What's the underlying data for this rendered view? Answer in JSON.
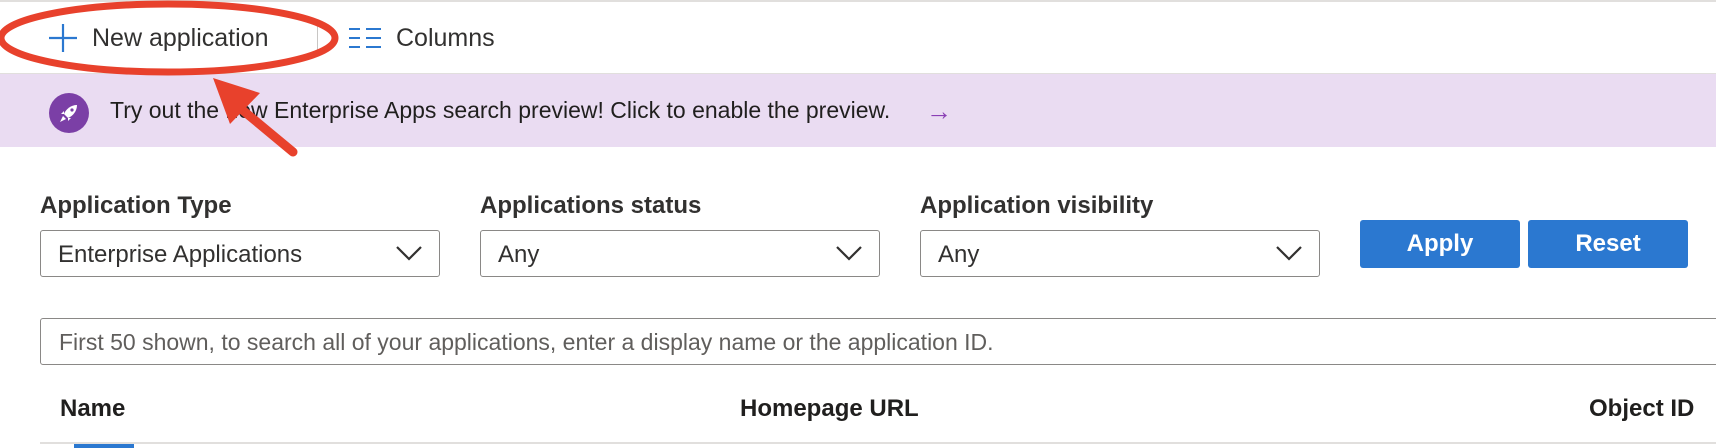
{
  "toolbar": {
    "new_application_label": "New application",
    "columns_label": "Columns"
  },
  "banner": {
    "text": "Try out the new Enterprise Apps search preview! Click to enable the preview.",
    "arrow": "→",
    "icon": "rocket-icon"
  },
  "filters": {
    "application_type": {
      "label": "Application Type",
      "value": "Enterprise Applications"
    },
    "applications_status": {
      "label": "Applications status",
      "value": "Any"
    },
    "application_visibility": {
      "label": "Application visibility",
      "value": "Any"
    },
    "apply_label": "Apply",
    "reset_label": "Reset"
  },
  "search": {
    "placeholder": "First 50 shown, to search all of your applications, enter a display name or the application ID."
  },
  "table": {
    "columns": [
      "Name",
      "Homepage URL",
      "Object ID"
    ]
  },
  "colors": {
    "accent": "#2b78d0",
    "banner_bg": "#eadcf2",
    "banner_icon": "#7b3fa6",
    "annotation": "#e8412c"
  }
}
